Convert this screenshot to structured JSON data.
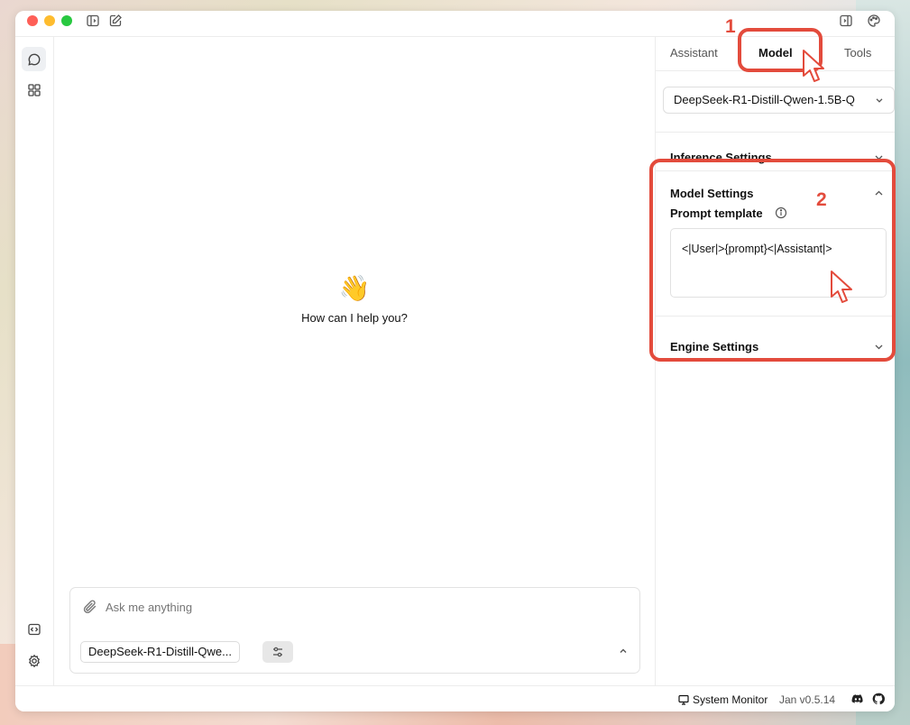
{
  "titlebar": {
    "icons": [
      "sidebar-toggle-icon",
      "new-chat-icon",
      "panel-toggle-icon",
      "palette-icon"
    ]
  },
  "leftbar": {
    "items": [
      {
        "name": "chat-icon",
        "active": true
      },
      {
        "name": "grid-icon",
        "active": false
      },
      {
        "name": "code-icon",
        "active": false
      },
      {
        "name": "gear-icon",
        "active": false
      }
    ]
  },
  "main": {
    "welcome_emoji": "👋",
    "welcome_text": "How can I help you?",
    "composer": {
      "placeholder": "Ask me anything",
      "model_chip": "DeepSeek-R1-Distill-Qwe..."
    }
  },
  "right_panel": {
    "tabs": [
      {
        "label": "Assistant",
        "active": false
      },
      {
        "label": "Model",
        "active": true
      },
      {
        "label": "Tools",
        "active": false
      }
    ],
    "model_select": "DeepSeek-R1-Distill-Qwen-1.5B-Q",
    "sections": {
      "inference": "Inference Settings",
      "model": "Model Settings",
      "engine": "Engine Settings"
    },
    "prompt_template": {
      "label": "Prompt template",
      "value": "<|User|>{prompt}<|Assistant|>"
    }
  },
  "statusbar": {
    "system_monitor": "System Monitor",
    "version": "Jan v0.5.14"
  },
  "annotations": {
    "step1": "1",
    "step2": "2",
    "color": "#e34b3c"
  }
}
